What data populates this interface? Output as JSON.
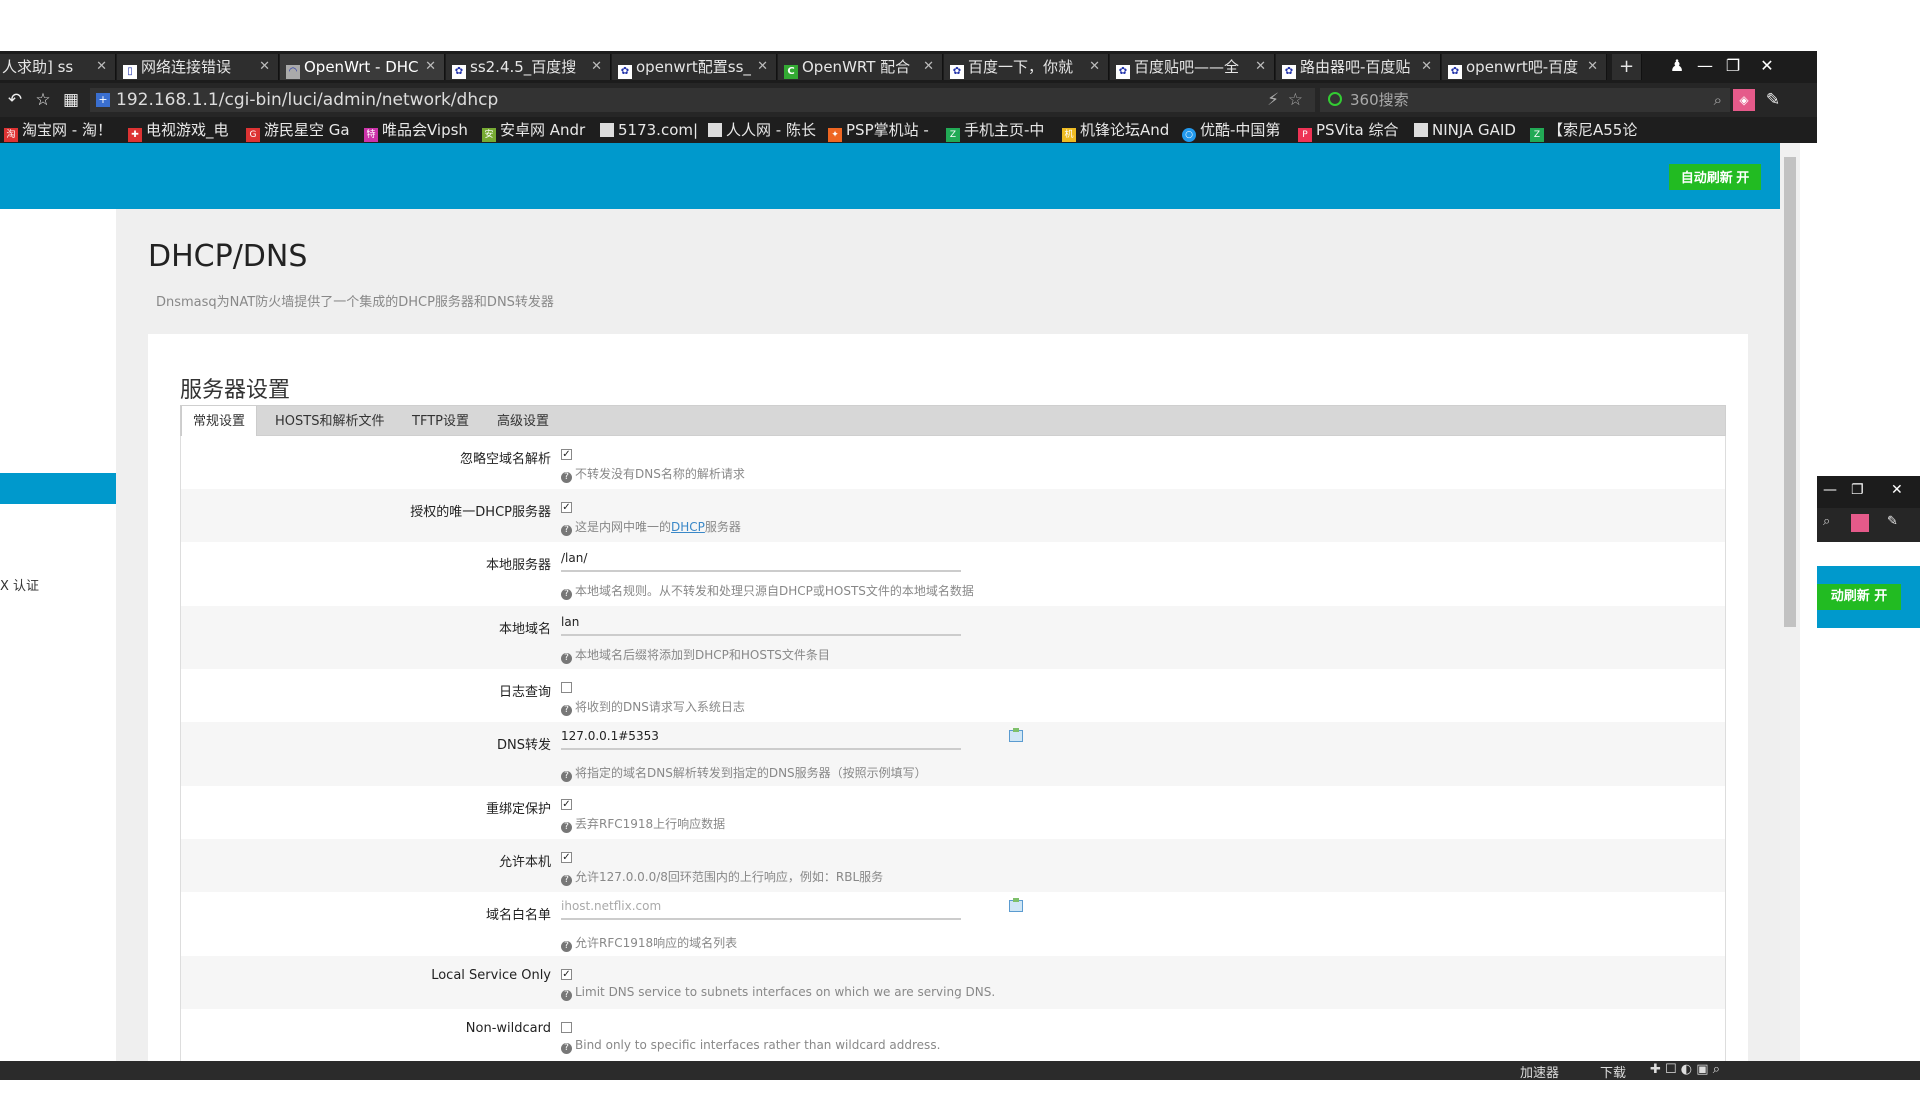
{
  "browser": {
    "tabs": [
      {
        "label": "人求助] ss",
        "active": false
      },
      {
        "label": "网络连接错误",
        "active": false
      },
      {
        "label": "OpenWrt - DHC",
        "active": true
      },
      {
        "label": "ss2.4.5_百度搜",
        "active": false
      },
      {
        "label": "openwrt配置ss_",
        "active": false
      },
      {
        "label": "OpenWRT 配合",
        "active": false
      },
      {
        "label": "百度一下，你就",
        "active": false
      },
      {
        "label": "百度贴吧——全",
        "active": false
      },
      {
        "label": "路由器吧-百度贴",
        "active": false
      },
      {
        "label": "openwrt吧-百度",
        "active": false
      }
    ],
    "new_tab": "+",
    "url": "192.168.1.1/cgi-bin/luci/admin/network/dhcp",
    "search_placeholder": "360搜索",
    "bookmarks": [
      "淘宝网 - 淘！",
      "电视游戏_电",
      "游民星空 Ga",
      "唯品会Vipsh",
      "安卓网 Andr",
      "5173.com|",
      "人人网 - 陈长",
      "PSP掌机站 -",
      "手机主页-中",
      "机锋论坛And",
      "优酷-中国第",
      "PSVita 综合",
      "NINJA GAID",
      "【索尼A55论"
    ],
    "status_bar": [
      "加速器",
      "下载"
    ]
  },
  "header": {
    "autorefresh": "自动刷新 开",
    "accent": "#0099cc",
    "button_color": "#22bb22"
  },
  "sidebar": {
    "item": "X 认证"
  },
  "page": {
    "title": "DHCP/DNS",
    "description": "Dnsmasq为NAT防火墙提供了一个集成的DHCP服务器和DNS转发器",
    "section_title": "服务器设置",
    "tabs": [
      "常规设置",
      "HOSTS和解析文件",
      "TFTP设置",
      "高级设置"
    ],
    "fields": [
      {
        "label": "忽略空域名解析",
        "type": "checkbox",
        "checked": true,
        "help": "不转发没有DNS名称的解析请求"
      },
      {
        "label": "授权的唯一DHCP服务器",
        "type": "checkbox",
        "checked": true,
        "help_prefix": "这是内网中唯一的",
        "help_link": "DHCP",
        "help_suffix": "服务器"
      },
      {
        "label": "本地服务器",
        "type": "text",
        "value": "/lan/",
        "help": "本地域名规则。从不转发和处理只源自DHCP或HOSTS文件的本地域名数据"
      },
      {
        "label": "本地域名",
        "type": "text",
        "value": "lan",
        "help": "本地域名后缀将添加到DHCP和HOSTS文件条目"
      },
      {
        "label": "日志查询",
        "type": "checkbox",
        "checked": false,
        "help": "将收到的DNS请求写入系统日志"
      },
      {
        "label": "DNS转发",
        "type": "text",
        "value": "127.0.0.1#5353",
        "help": "将指定的域名DNS解析转发到指定的DNS服务器（按照示例填写）"
      },
      {
        "label": "重绑定保护",
        "type": "checkbox",
        "checked": true,
        "help": "丢弃RFC1918上行响应数据"
      },
      {
        "label": "允许本机",
        "type": "checkbox",
        "checked": true,
        "help": "允许127.0.0.0/8回环范围内的上行响应，例如：RBL服务"
      },
      {
        "label": "域名白名单",
        "type": "text",
        "value": "",
        "placeholder": "ihost.netflix.com",
        "help": "允许RFC1918响应的域名列表"
      },
      {
        "label": "Local Service Only",
        "type": "checkbox",
        "checked": true,
        "help": "Limit DNS service to subnets interfaces on which we are serving DNS."
      },
      {
        "label": "Non-wildcard",
        "type": "checkbox",
        "checked": false,
        "help": "Bind only to specific interfaces rather than wildcard address."
      }
    ]
  },
  "ghost_window": {
    "autorefresh": "动刷新 开"
  }
}
